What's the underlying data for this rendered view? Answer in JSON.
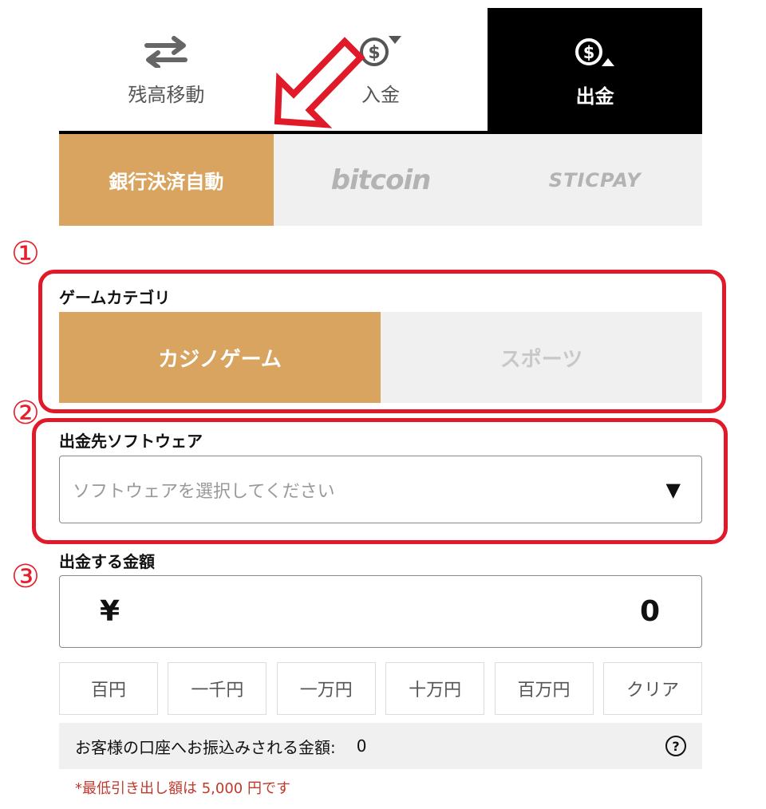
{
  "top_tabs": [
    {
      "label": "残高移動",
      "icon": "transfer-arrows-icon",
      "active": false
    },
    {
      "label": "入金",
      "icon": "dollar-coin-down-icon",
      "active": false
    },
    {
      "label": "出金",
      "icon": "dollar-coin-up-icon",
      "active": true
    }
  ],
  "methods": [
    {
      "label": "銀行決済自動",
      "active": true
    },
    {
      "label": "bitcoin",
      "active": false
    },
    {
      "label": "STICPAY",
      "active": false
    }
  ],
  "annotations": {
    "one": "①",
    "two": "②",
    "three": "③"
  },
  "category": {
    "label": "ゲームカテゴリ",
    "options": [
      {
        "label": "カジノゲーム",
        "active": true
      },
      {
        "label": "スポーツ",
        "active": false
      }
    ]
  },
  "software": {
    "label": "出金先ソフトウェア",
    "placeholder": "ソフトウェアを選択してください"
  },
  "amount": {
    "label": "出金する金額",
    "currency": "¥",
    "value": "0"
  },
  "quick_buttons": [
    "百円",
    "一千円",
    "一万円",
    "十万円",
    "百万円",
    "クリア"
  ],
  "receive": {
    "label": "お客様の口座へお振込みされる金額:",
    "value": "0",
    "help_glyph": "?"
  },
  "note": "*最低引き出し額は 5,000 円です",
  "colors": {
    "accent": "#d8a460",
    "highlight": "#e01a28",
    "note": "#c0392b"
  }
}
